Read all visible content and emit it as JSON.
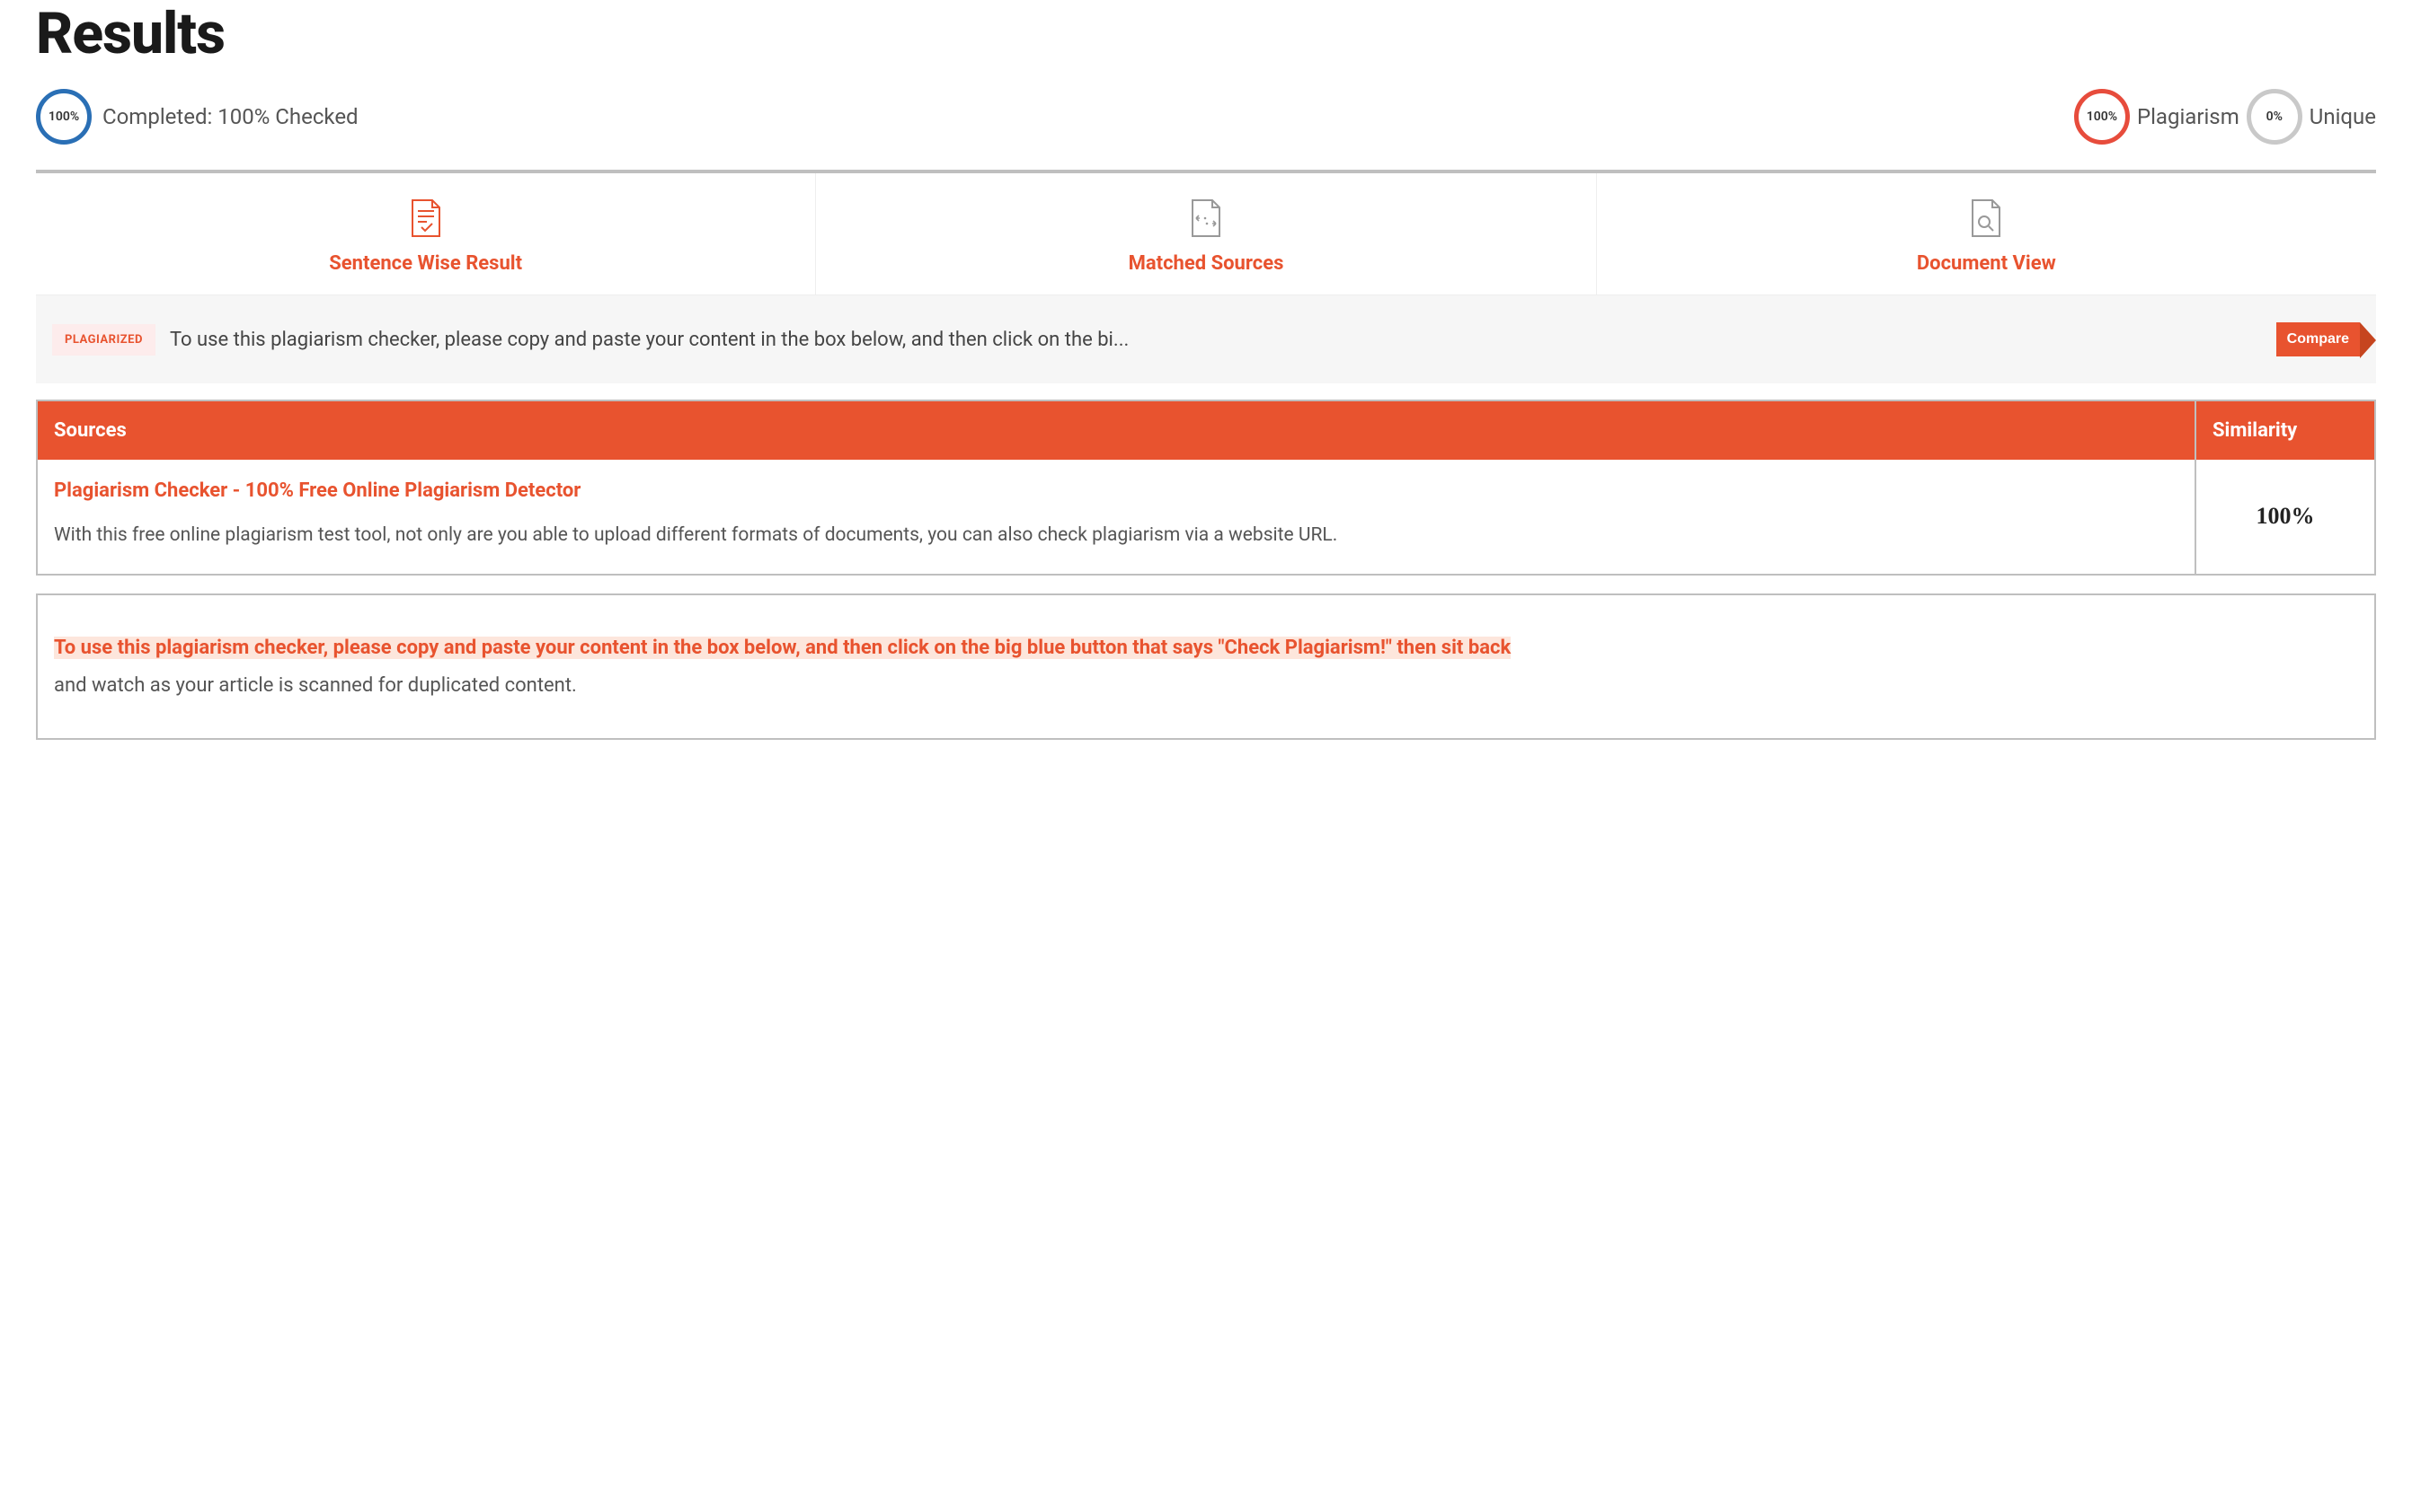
{
  "title": "Results",
  "stats": {
    "completion": {
      "ring": "100%",
      "label": "Completed: 100% Checked"
    },
    "plagiarism": {
      "ring": "100%",
      "label": "Plagiarism"
    },
    "unique": {
      "ring": "0%",
      "label": "Unique"
    }
  },
  "tabs": {
    "sentence": "Sentence Wise Result",
    "matched": "Matched Sources",
    "document": "Document View"
  },
  "sentence_panel": {
    "tag": "PLAGIARIZED",
    "text": "To use this plagiarism checker, please copy and paste your content in the box below, and then click on the bi...",
    "compare": "Compare"
  },
  "sources_table": {
    "header_sources": "Sources",
    "header_similarity": "Similarity",
    "rows": [
      {
        "title": "Plagiarism Checker - 100% Free Online Plagiarism Detector",
        "desc": "With this free online plagiarism test tool, not only are you able to upload different formats of documents, you can also check plagiarism via a website URL.",
        "similarity": "100%"
      }
    ]
  },
  "doc_view": {
    "highlighted": " To use this plagiarism checker, please copy and paste your content in the box below, and then click on the big blue button that says \"Check Plagiarism!\" then sit back ",
    "rest": "and watch as your article is scanned for duplicated content."
  }
}
